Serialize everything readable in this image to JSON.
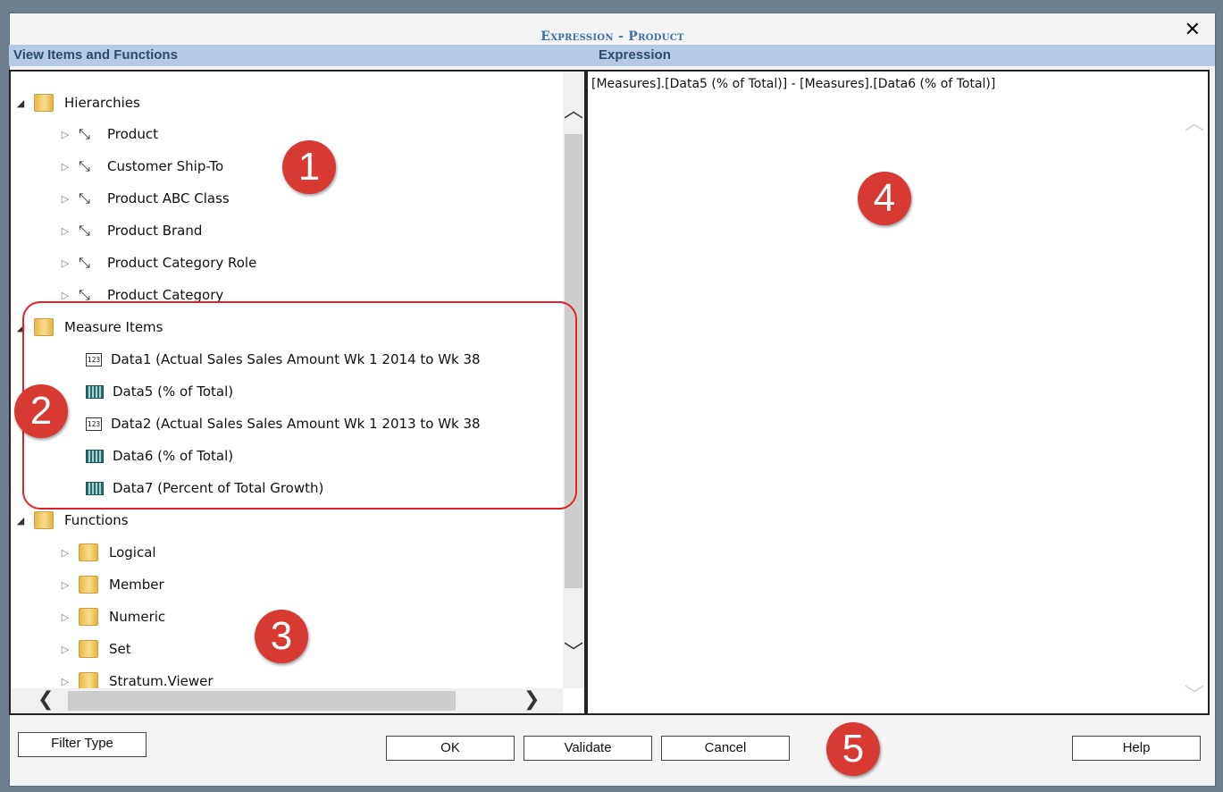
{
  "dialog": {
    "title": "Expression - Product",
    "close_glyph": "✕"
  },
  "left_panel": {
    "header": "View Items and Functions"
  },
  "right_panel": {
    "header": "Expression",
    "expression_text": "[Measures].[Data5 (% of Total)] - [Measures].[Data6 (% of Total)]"
  },
  "tree": {
    "hierarchies": {
      "label": "Hierarchies",
      "items": [
        "Product",
        "Customer Ship-To",
        "Product ABC Class",
        "Product Brand",
        "Product Category Role",
        "Product Category"
      ]
    },
    "measure_items": {
      "label": "Measure Items",
      "items": [
        {
          "label": "Data1 (Actual Sales Sales Amount Wk 1 2014 to Wk 38",
          "icon": "numeric-measure-icon"
        },
        {
          "label": "Data5 (% of Total)",
          "icon": "calculated-measure-icon"
        },
        {
          "label": "Data2 (Actual Sales Sales Amount Wk 1 2013 to Wk 38",
          "icon": "numeric-measure-icon"
        },
        {
          "label": "Data6 (% of Total)",
          "icon": "calculated-measure-icon"
        },
        {
          "label": "Data7 (Percent of Total Growth)",
          "icon": "calculated-measure-icon"
        }
      ]
    },
    "functions": {
      "label": "Functions",
      "items": [
        "Logical",
        "Member",
        "Numeric",
        "Set",
        "Stratum.Viewer"
      ]
    }
  },
  "callouts": [
    "1",
    "2",
    "3",
    "4",
    "5"
  ],
  "buttons": {
    "filter_type": "Filter Type",
    "ok": "OK",
    "validate": "Validate",
    "cancel": "Cancel",
    "help": "Help"
  },
  "colors": {
    "title": "#3a6fa8",
    "header_bar": "#b5cbe5",
    "callout": "#d63a32",
    "highlight": "#e0232b"
  }
}
